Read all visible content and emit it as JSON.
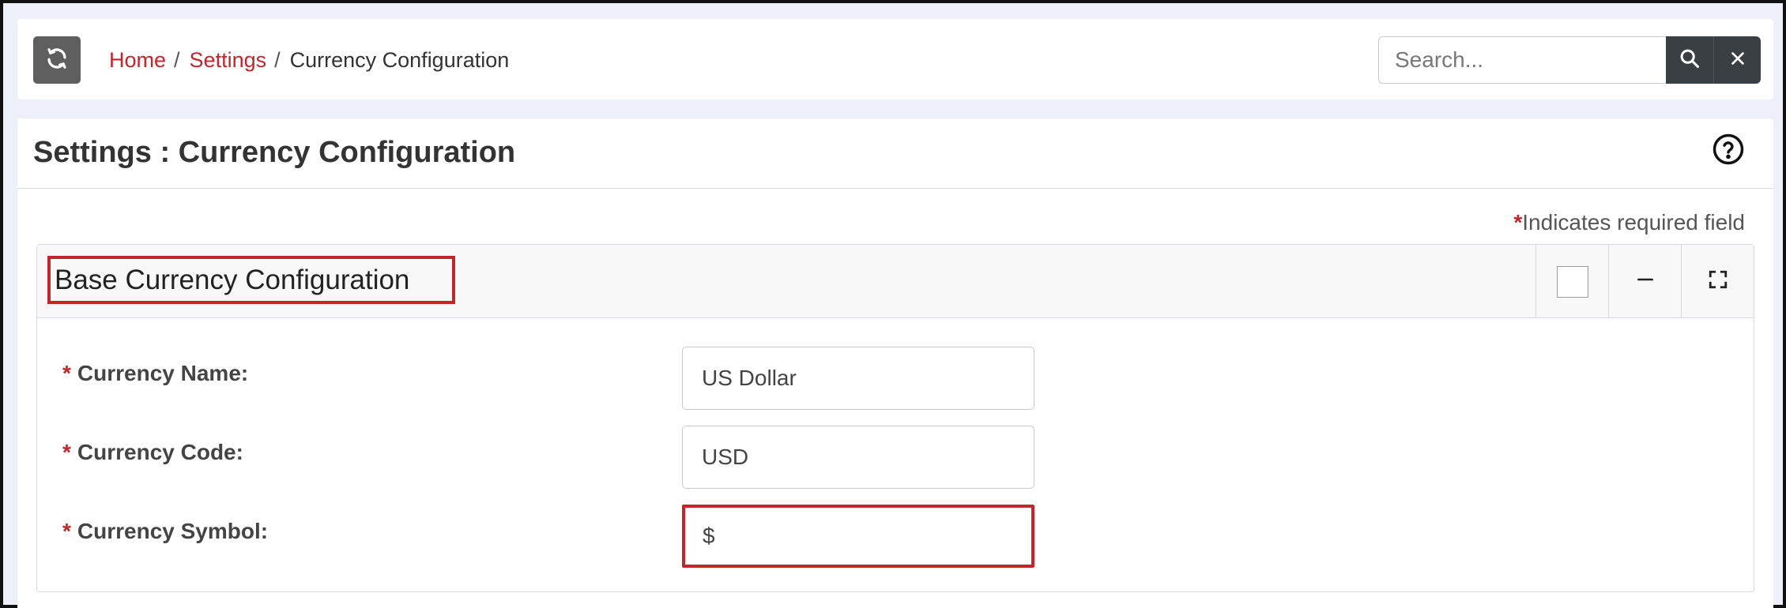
{
  "breadcrumb": {
    "items": [
      "Home",
      "Settings",
      "Currency Configuration"
    ],
    "separator": "/"
  },
  "search": {
    "placeholder": "Search..."
  },
  "page": {
    "title": "Settings : Currency Configuration",
    "required_star": "*",
    "required_note": "Indicates required field"
  },
  "card": {
    "title": "Base Currency Configuration"
  },
  "form": {
    "fields": [
      {
        "star": "*",
        "label": "Currency Name:",
        "value": "US Dollar"
      },
      {
        "star": "*",
        "label": "Currency Code:",
        "value": "USD"
      },
      {
        "star": "*",
        "label": "Currency Symbol:",
        "value": "$"
      }
    ]
  },
  "icons": {
    "refresh": "refresh-icon",
    "search": "search-icon",
    "clear": "close-icon",
    "help": "help-circle-icon",
    "minimize": "minus-icon",
    "fullscreen": "expand-icon"
  },
  "colors": {
    "accent_red": "#c0272d",
    "dark_button": "#3a3f44",
    "refresh_button": "#5f5f5f"
  }
}
